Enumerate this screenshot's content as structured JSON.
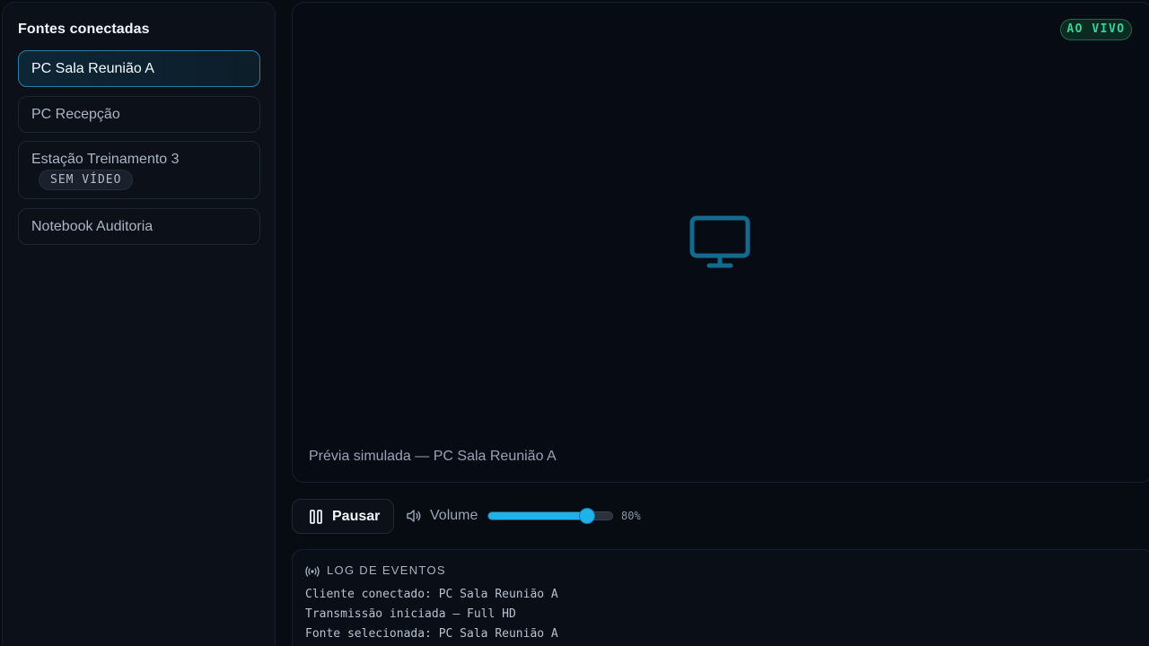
{
  "sidebar": {
    "title": "Fontes conectadas",
    "sources": [
      {
        "label": "PC Sala Reunião A",
        "active": true
      },
      {
        "label": "PC Recepção"
      },
      {
        "label": "Estação Treinamento 3",
        "badge": "SEM VÍDEO"
      },
      {
        "label": "Notebook Auditoria"
      }
    ]
  },
  "preview": {
    "live_badge": "AO VIVO",
    "icon": "monitor-icon",
    "caption": "Prévia simulada — PC Sala Reunião A"
  },
  "controls": {
    "pause_label": "Pausar",
    "volume_label": "Volume",
    "volume_value": "80%",
    "volume_level": 0.8
  },
  "log": {
    "title": "LOG DE EVENTOS",
    "lines": [
      "Cliente conectado: PC Sala Reunião A",
      "Transmissão iniciada — Full HD",
      "Fonte selecionada: PC Sala Reunião A"
    ]
  },
  "colors": {
    "accent": "#1fb2ea",
    "live": "#35d39a",
    "background": "#070b12"
  }
}
